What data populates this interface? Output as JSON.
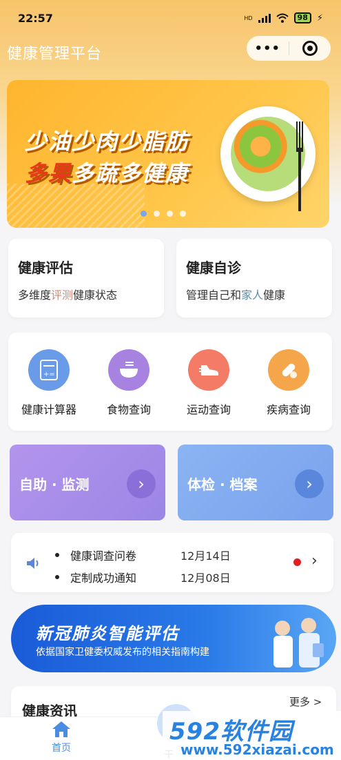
{
  "status_bar": {
    "time": "22:57",
    "battery": "98",
    "network": "HD"
  },
  "nav": {
    "title": "健康管理平台",
    "more_icon": "more-dots-icon",
    "close_icon": "target-icon"
  },
  "banner": {
    "line1": "少油少肉少脂肪",
    "line2_highlight": "多果",
    "line2_rest": "多蔬多健康",
    "page_count": 4,
    "active_page": 1
  },
  "cards": {
    "assess": {
      "title": "健康评估",
      "sub_pre": "多维度",
      "sub_hl": "评测",
      "sub_post": "健康状态"
    },
    "self_diag": {
      "title": "健康自诊",
      "sub_pre": "管理自己和",
      "sub_hl": "家人",
      "sub_post": "健康"
    }
  },
  "tools": [
    {
      "label": "健康计算器",
      "icon": "calculator-icon",
      "color": "#6a9be8"
    },
    {
      "label": "食物查询",
      "icon": "bowl-icon",
      "color": "#a782e0"
    },
    {
      "label": "运动查询",
      "icon": "shoe-icon",
      "color": "#f47b66"
    },
    {
      "label": "疾病查询",
      "icon": "pill-icon",
      "color": "#f6a64a"
    }
  ],
  "actions": {
    "self_monitor": {
      "label": "自助 · 监测"
    },
    "checkup": {
      "label": "体检 · 档案"
    }
  },
  "notices": [
    {
      "text": "健康调查问卷",
      "date": "12月14日"
    },
    {
      "text": "定制成功通知",
      "date": "12月08日"
    }
  ],
  "covid": {
    "title": "新冠肺炎智能评估",
    "subtitle": "依据国家卫健委权威发布的相关指南构建"
  },
  "news": {
    "title": "健康资讯",
    "more": "更多 >"
  },
  "tabbar": {
    "home": "首页",
    "mid": "干"
  },
  "watermark": {
    "logo": "592软件园",
    "url": "www.592xiazai.com"
  },
  "colors": {
    "accent": "#4a8de0",
    "banner": "#ffb52e",
    "covid": "#1a5bd8"
  }
}
